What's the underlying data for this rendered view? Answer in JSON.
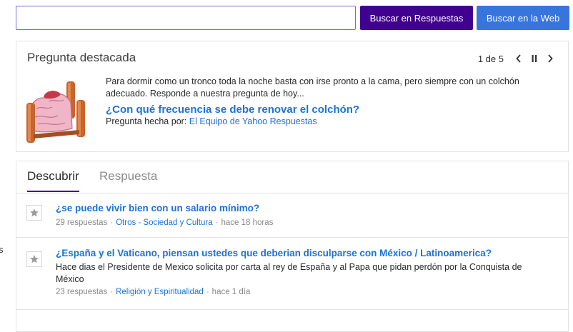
{
  "search": {
    "placeholder": "",
    "value": "",
    "answers_button": "Buscar en Respuestas",
    "web_button": "Buscar en la Web"
  },
  "featured": {
    "title": "Pregunta destacada",
    "pager": "1 de 5",
    "image_alt": "bed-with-mattress",
    "text": "Para dormir como un tronco toda la noche basta con irse pronto a la cama, pero siempre con un colchón adecuado. Responde a nuestra pregunta de hoy...",
    "question": "¿Con qué frecuencia se debe renovar el colchón?",
    "asked_by_label": "Pregunta hecha por:",
    "asked_by_name": "El Equipo de Yahoo Respuestas"
  },
  "tabs": {
    "discover": "Descubrir",
    "answer": "Respuesta"
  },
  "questions": [
    {
      "title": "¿se puede vivir bien con un salario mínimo?",
      "answers": "29 respuestas",
      "category": "Otros - Sociedad y Cultura",
      "time": "hace 18 horas"
    },
    {
      "title": "¿España y el Vaticano, piensan ustedes que deberian disculparse con México / Latinoamerica?",
      "description": "Hace dias el Presidente de Mexico solicita por carta al rey de España y al Papa que pidan perdón por la Conquista de México",
      "answers": "23 respuestas",
      "category": "Religión y Espiritualidad",
      "time": "hace 1 día"
    }
  ],
  "edge_text": "s",
  "colors": {
    "answers_button": "#400090",
    "web_button": "#3775dd",
    "link": "#1a73d9",
    "tab_underline": "#400090"
  },
  "icons": [
    "chevron-left-icon",
    "pause-icon",
    "chevron-right-icon",
    "star-icon"
  ]
}
